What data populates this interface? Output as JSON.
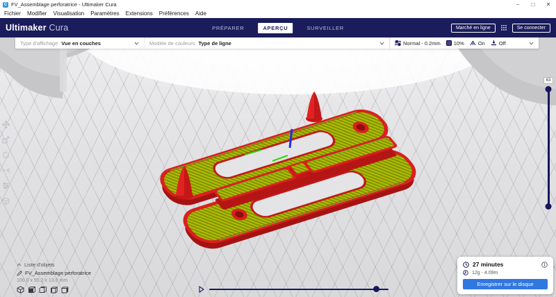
{
  "window": {
    "title": "FV_Assemblage perforatrice - Ultimaker Cura",
    "controls": {
      "minimize": "–",
      "maximize": "□",
      "close": "✕"
    }
  },
  "menubar": {
    "items": [
      "Fichier",
      "Modifier",
      "Visualisation",
      "Paramètres",
      "Extensions",
      "Préférences",
      "Aide"
    ]
  },
  "header": {
    "brand_bold": "Ultimaker",
    "brand_light": "Cura",
    "tabs": [
      {
        "label": "PRÉPARER"
      },
      {
        "label": "APERÇU"
      },
      {
        "label": "SURVEILLER"
      }
    ],
    "marketplace_label": "Marché en ligne",
    "sign_in_label": "Se connecter"
  },
  "toolbar": {
    "display_type_label": "Type d'affichage",
    "display_type_value": "Vue en couches",
    "color_scheme_label": "Modèle de couleurs",
    "color_scheme_value": "Type de ligne",
    "profile": "Normal - 0.2mm",
    "infill": "10%",
    "support": "On",
    "adhesion": "Off"
  },
  "viewport": {
    "layer_value": "63",
    "object_list_label": "Liste d'objets",
    "object_name": "FV_Assemblage perforatrice",
    "object_dimensions": "100.0 x 55.2 x 13.0 mm",
    "tool_names": [
      "move",
      "scale",
      "rotate",
      "mirror",
      "per-model-settings",
      "support-blocker"
    ],
    "view_preset_names": [
      "3d-view",
      "front-view",
      "top-view",
      "left-view",
      "right-view"
    ]
  },
  "print_panel": {
    "time": "27 minutes",
    "material": "12g - 4.09m",
    "save_button": "Enregistrer sur le disque"
  },
  "colors": {
    "header_navy": "#1b1c5b",
    "button_blue": "#3177e0",
    "model_red": "#e02020",
    "model_olive": "#a3b000",
    "model_green_edge": "#5ad31e",
    "slider_navy": "#16165e"
  }
}
